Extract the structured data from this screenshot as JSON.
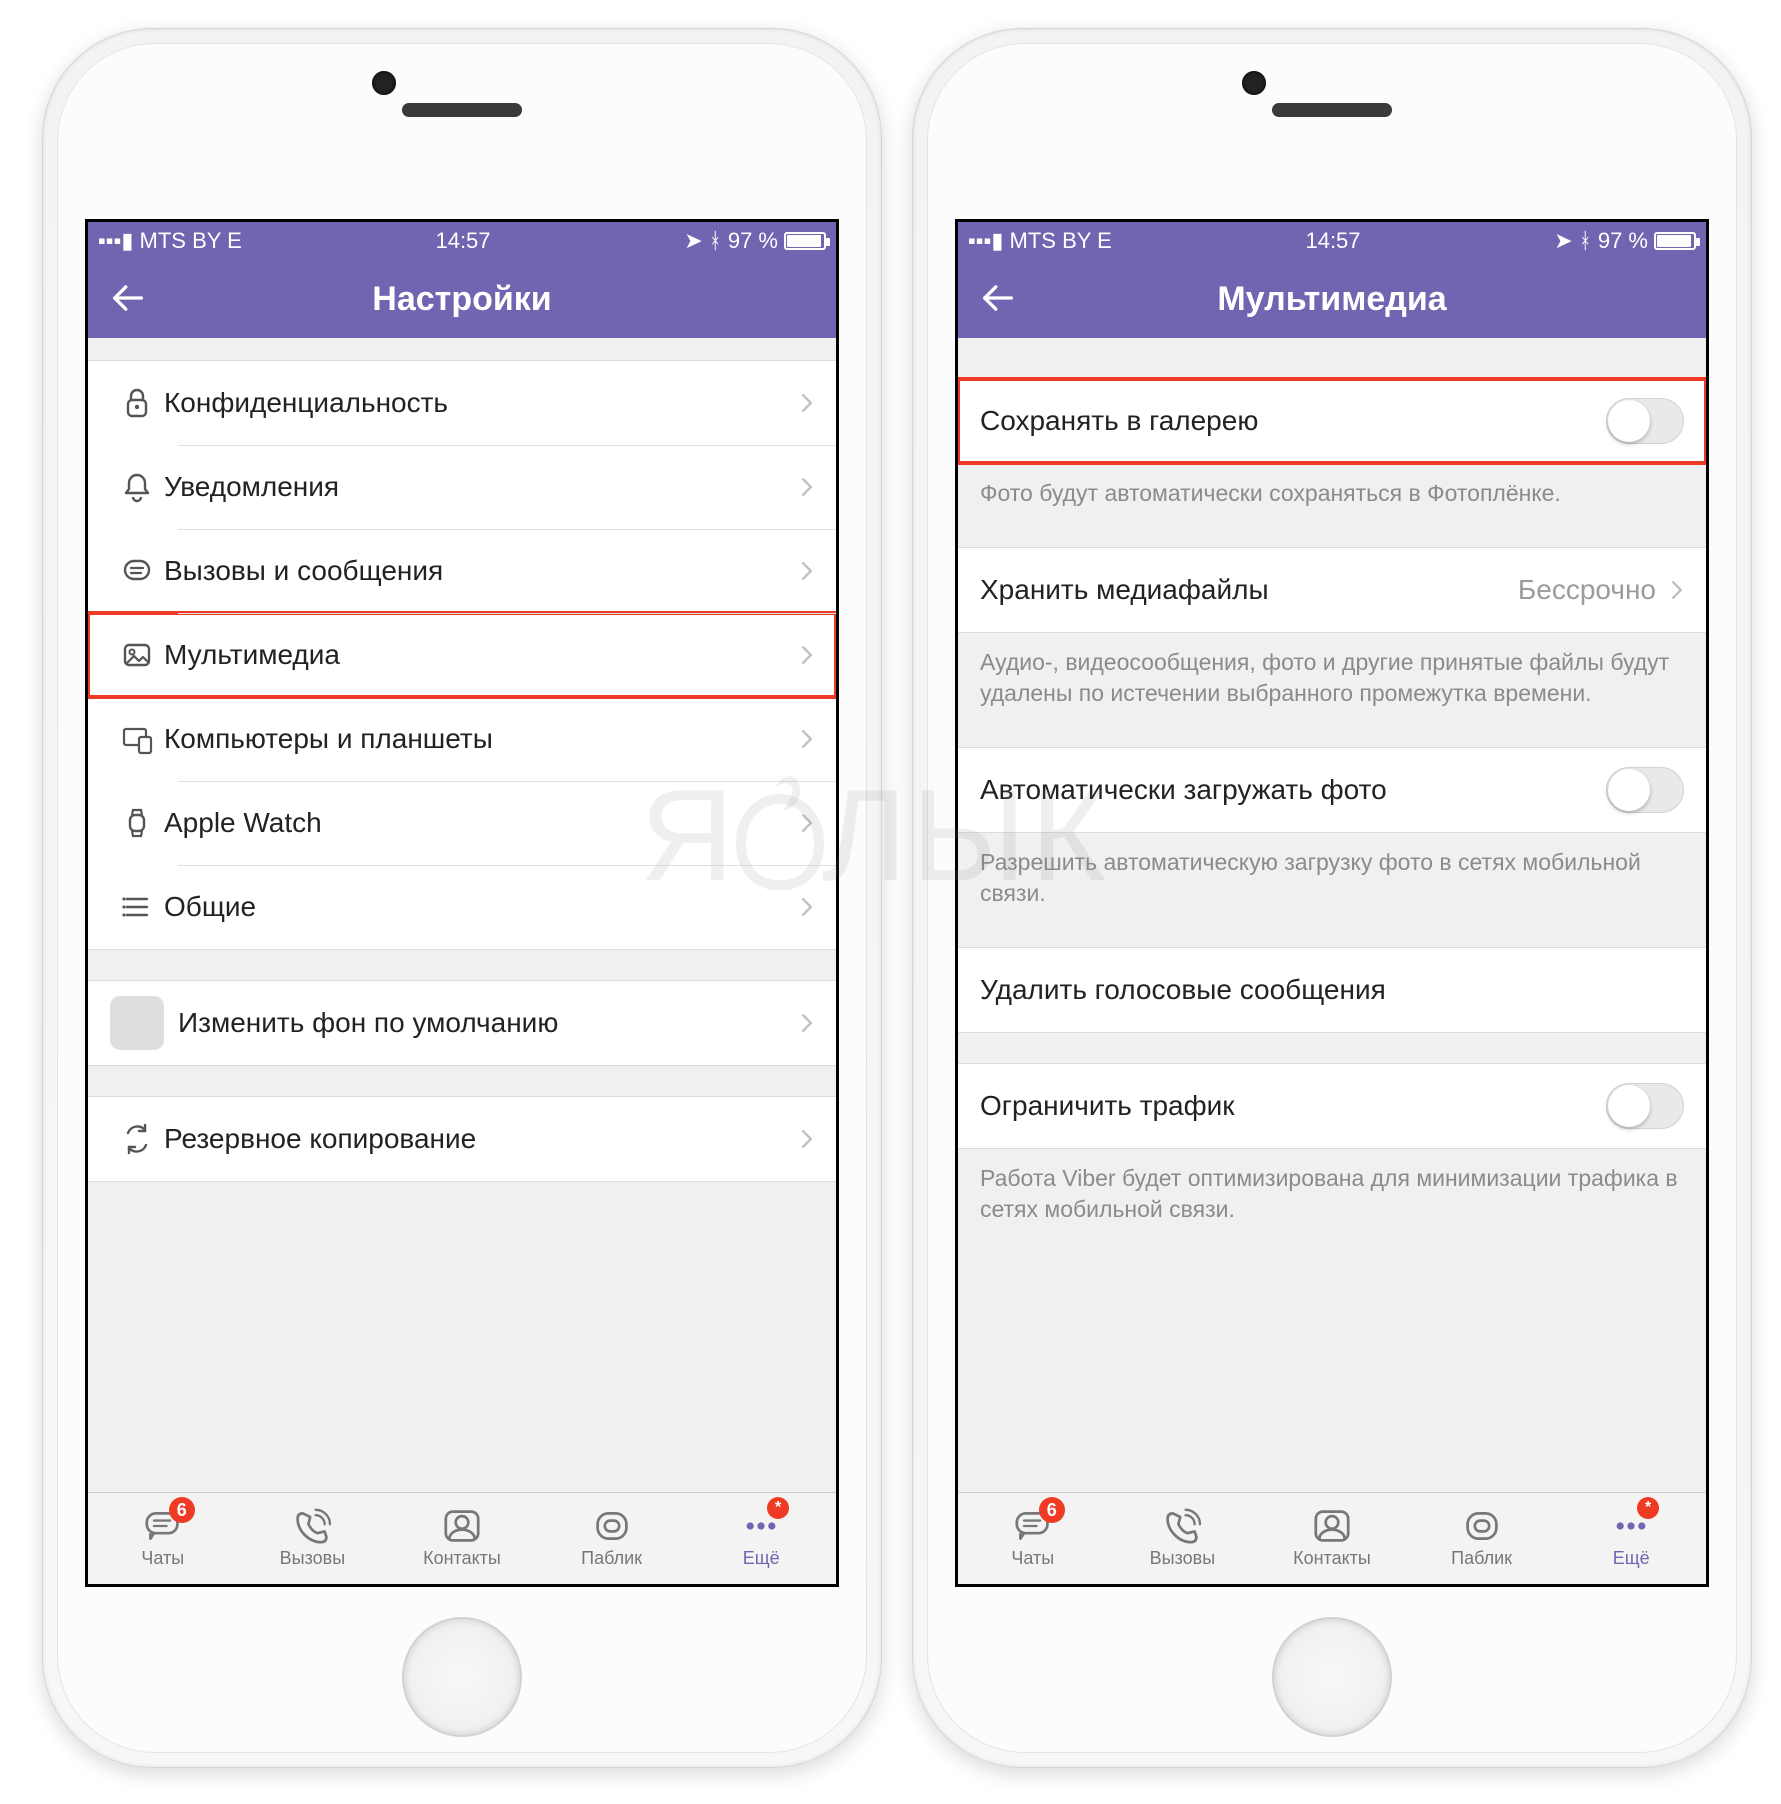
{
  "status": {
    "carrier": "MTS BY  E",
    "time": "14:57",
    "battery": "97 %"
  },
  "left": {
    "title": "Настройки",
    "rows": {
      "privacy": "Конфиденциальность",
      "notif": "Уведомления",
      "calls": "Вызовы и сообщения",
      "media": "Мультимедиа",
      "devices": "Компьютеры и планшеты",
      "watch": "Apple Watch",
      "general": "Общие",
      "wallpaper": "Изменить фон по умолчанию",
      "backup": "Резервное копирование"
    }
  },
  "right": {
    "title": "Мультимедиа",
    "saveGallery": {
      "label": "Сохранять в галерею",
      "value": false
    },
    "saveGalleryNote": "Фото будут автоматически сохраняться в Фотоплёнке.",
    "storeMedia": {
      "label": "Хранить медиафайлы",
      "value": "Бессрочно"
    },
    "storeMediaNote": "Аудио-, видеосообщения, фото и другие принятые файлы будут удалены по истечении выбранного промежутка времени.",
    "autoDownload": {
      "label": "Автоматически загружать фото",
      "value": false
    },
    "autoDownloadNote": "Разрешить автоматическую загрузку фото в сетях мобильной связи.",
    "deleteVoice": "Удалить голосовые сообщения",
    "limitTraffic": {
      "label": "Ограничить трафик",
      "value": false
    },
    "limitTrafficNote": "Работа Viber будет оптимизирована для минимизации трафика в сетях мобильной связи."
  },
  "tabs": {
    "chats": {
      "label": "Чаты",
      "badge": "6"
    },
    "calls": {
      "label": "Вызовы"
    },
    "contacts": {
      "label": "Контакты"
    },
    "public": {
      "label": "Паблик"
    },
    "more": {
      "label": "Ещё",
      "badge": "*"
    }
  },
  "watermark": {
    "a": "Я",
    "b": "ЛЫК"
  }
}
